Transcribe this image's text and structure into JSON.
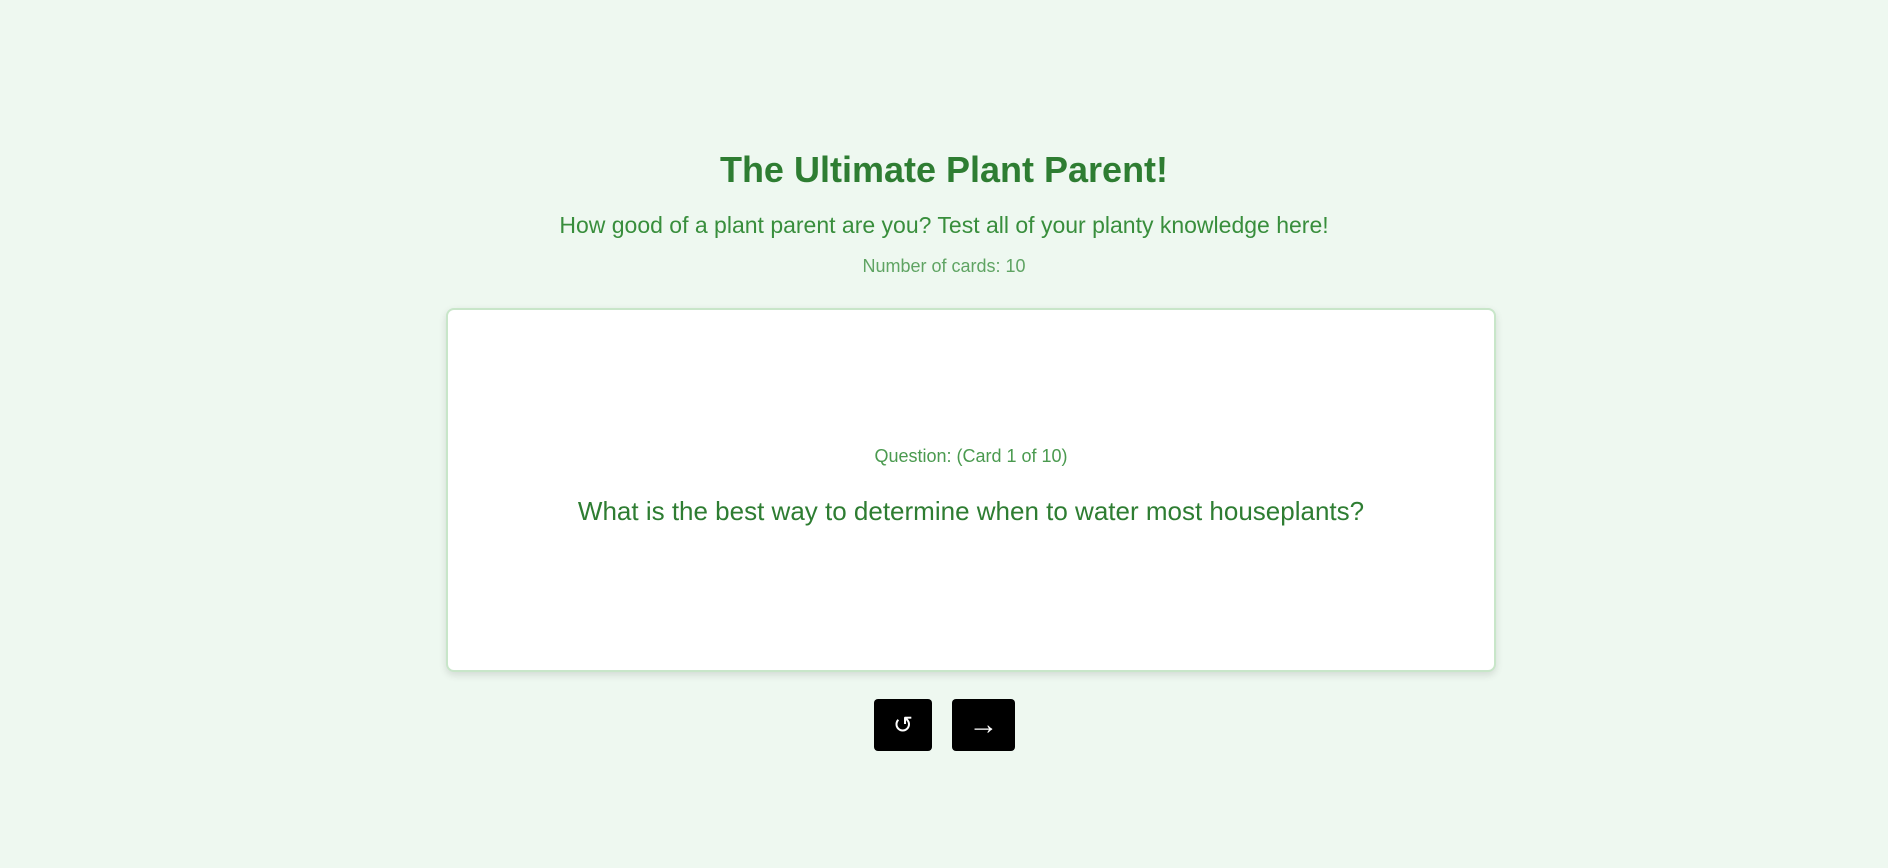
{
  "header": {
    "title": "The Ultimate Plant Parent!",
    "subtitle": "How good of a plant parent are you? Test all of your planty knowledge here!",
    "card_count_text": "Number of cards: 10"
  },
  "card": {
    "label": "Question: (Card 1 of 10)",
    "question": "What is the best way to determine when to water most houseplants?"
  },
  "controls": {
    "reset_icon": "↺",
    "next_icon": "→",
    "reset_icon_name": "reset-icon",
    "next_icon_name": "arrow-right-icon"
  },
  "colors": {
    "background": "#eef8f0",
    "title": "#2e7d32",
    "card_border": "#c8e6c9",
    "button": "#000000"
  }
}
